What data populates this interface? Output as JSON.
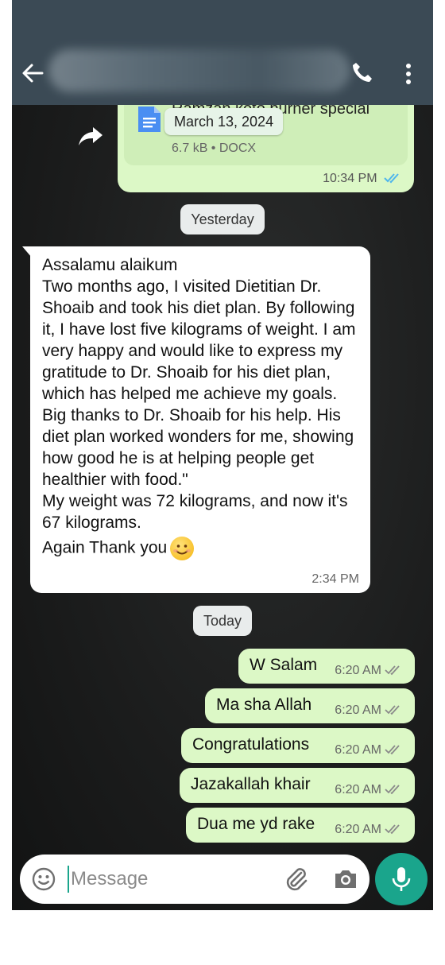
{
  "header": {
    "back_icon": "arrow-left-icon",
    "call_icon": "phone-icon",
    "more_icon": "more-vertical-icon"
  },
  "document_message": {
    "file_name": "Ramzan keto burner special",
    "file_size": "6.7 kB",
    "file_type": "DOCX",
    "meta": "6.7 kB • DOCX",
    "time": "10:34 PM",
    "status": "read",
    "floating_date": "March 13, 2024",
    "forward_icon": "forward-icon"
  },
  "dividers": {
    "yesterday": "Yesterday",
    "today": "Today"
  },
  "incoming_message": {
    "text": "Assalamu alaikum\nTwo months ago, I visited Dietitian Dr. Shoaib and took his diet plan. By following it, I have lost five kilograms of weight. I am very happy and would like to express my gratitude to Dr. Shoaib for his diet plan, which has helped me achieve my goals.\nBig thanks to Dr. Shoaib for his help. His diet plan worked wonders for me, showing how good he is at helping people get healthier with food.\"\nMy weight was 72 kilograms, and now it's 67 kilograms.",
    "closing": "Again Thank you",
    "emoji": "smiling-face-emoji",
    "time": "2:34 PM"
  },
  "outgoing_messages": [
    {
      "text": "W Salam",
      "time": "6:20 AM",
      "status": "delivered"
    },
    {
      "text": "Ma sha Allah",
      "time": "6:20 AM",
      "status": "delivered"
    },
    {
      "text": "Congratulations",
      "time": "6:20 AM",
      "status": "delivered"
    },
    {
      "text": "Jazakallah khair",
      "time": "6:20 AM",
      "status": "delivered"
    },
    {
      "text": "Dua me yd rake",
      "time": "6:20 AM",
      "status": "delivered"
    }
  ],
  "composer": {
    "placeholder": "Message",
    "emoji_icon": "emoji-icon",
    "attach_icon": "paperclip-icon",
    "camera_icon": "camera-icon",
    "mic_icon": "microphone-icon"
  },
  "colors": {
    "header": "#3b4a55",
    "outgoing_bubble": "#dcf8c6",
    "incoming_bubble": "#ffffff",
    "accent": "#1aa58c",
    "read_tick": "#4fb6ec"
  }
}
